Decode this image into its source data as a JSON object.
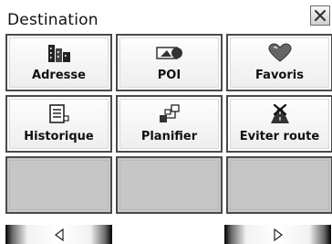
{
  "dialog": {
    "title": "Destination",
    "close_icon": "close-x-icon"
  },
  "buttons": [
    {
      "label": "Adresse",
      "icon": "buildings-icon"
    },
    {
      "label": "POI",
      "icon": "poi-flag-icon"
    },
    {
      "label": "Favoris",
      "icon": "heart-icon"
    },
    {
      "label": "Historique",
      "icon": "history-list-icon"
    },
    {
      "label": "Planifier",
      "icon": "route-plan-icon"
    },
    {
      "label": "Eviter route",
      "icon": "avoid-road-icon"
    }
  ],
  "nav": {
    "prev_icon": "triangle-left-icon",
    "next_icon": "triangle-right-icon"
  }
}
